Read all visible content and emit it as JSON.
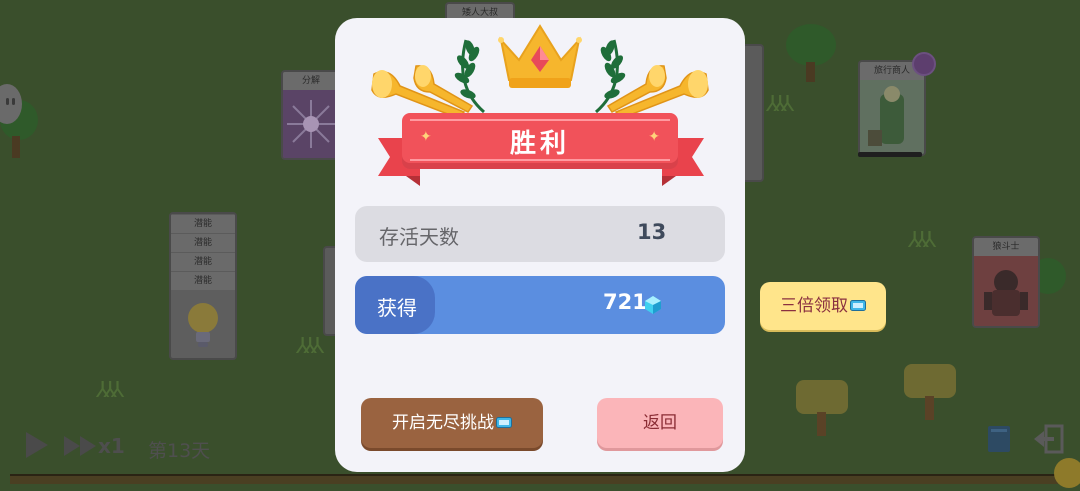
{
  "background": {
    "cards": [
      {
        "title": "矮人大叔"
      },
      {
        "title": "分解"
      },
      {
        "title": "旅行商人"
      },
      {
        "title": "狼斗士"
      }
    ],
    "potential_card": {
      "rows": [
        "潜能",
        "潜能",
        "潜能",
        "潜能"
      ]
    },
    "controls": {
      "speed_label": "x1",
      "day_label": "第13天"
    }
  },
  "modal": {
    "title": "胜利",
    "survive": {
      "label": "存活天数",
      "value": "13"
    },
    "earn": {
      "label": "获得",
      "value": "721",
      "icon": "gem-icon"
    },
    "buttons": {
      "endless": "开启无尽挑战",
      "return": "返回"
    }
  },
  "triple_button": {
    "label": "三倍领取"
  },
  "colors": {
    "banner": "#f1525a",
    "earn_row": "#5b8ee0",
    "endless_button": "#9a6340",
    "return_button": "#fbb5b9",
    "triple_button": "#ffe58b",
    "crown": "#f6b62d"
  }
}
